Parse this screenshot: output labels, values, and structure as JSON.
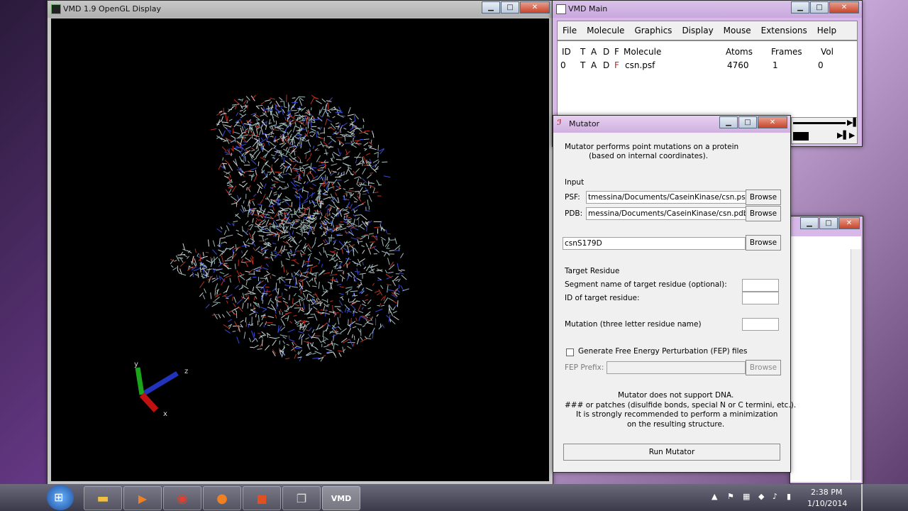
{
  "gl_window": {
    "title": "VMD 1.9 OpenGL Display",
    "axes": {
      "x": "x",
      "y": "y",
      "z": "z"
    }
  },
  "main_window": {
    "title": "VMD Main",
    "menu": [
      "File",
      "Molecule",
      "Graphics",
      "Display",
      "Mouse",
      "Extensions",
      "Help"
    ],
    "columns": {
      "id": "ID",
      "t": "T",
      "a": "A",
      "d": "D",
      "f": "F",
      "molecule": "Molecule",
      "atoms": "Atoms",
      "frames": "Frames",
      "vol": "Vol"
    },
    "row": {
      "id": "0",
      "t": "T",
      "a": "A",
      "d": "D",
      "f": "F",
      "molecule": "csn.psf",
      "atoms": "4760",
      "frames": "1",
      "vol": "0"
    }
  },
  "mutator": {
    "title": "Mutator",
    "desc_line1": "Mutator performs point mutations on a protein",
    "desc_line2": "(based on internal coordinates).",
    "input_label": "Input",
    "psf_label": "PSF:",
    "psf_value": "tmessina/Documents/CaseinKinase/csn.psf",
    "pdb_label": "PDB:",
    "pdb_value": "messina/Documents/CaseinKinase/csn.pdb",
    "output_value": "csnS179D",
    "browse": "Browse",
    "target_label": "Target Residue",
    "segment_label": "Segment name of target residue (optional):",
    "id_label": "ID of target residue:",
    "mutation_label": "Mutation (three letter residue name)",
    "fep_checkbox": "Generate Free Energy Perturbation (FEP) files",
    "fep_prefix_label": "FEP Prefix:",
    "note1": "Mutator does not support DNA.",
    "note2": "### or patches (disulfide bonds, special N or C termini, etc.).",
    "note3": "It is strongly recommended to perform a minimization",
    "note4": "on the resulting structure.",
    "run_button": "Run Mutator"
  },
  "taskbar": {
    "time": "2:38 PM",
    "date": "1/10/2014"
  }
}
